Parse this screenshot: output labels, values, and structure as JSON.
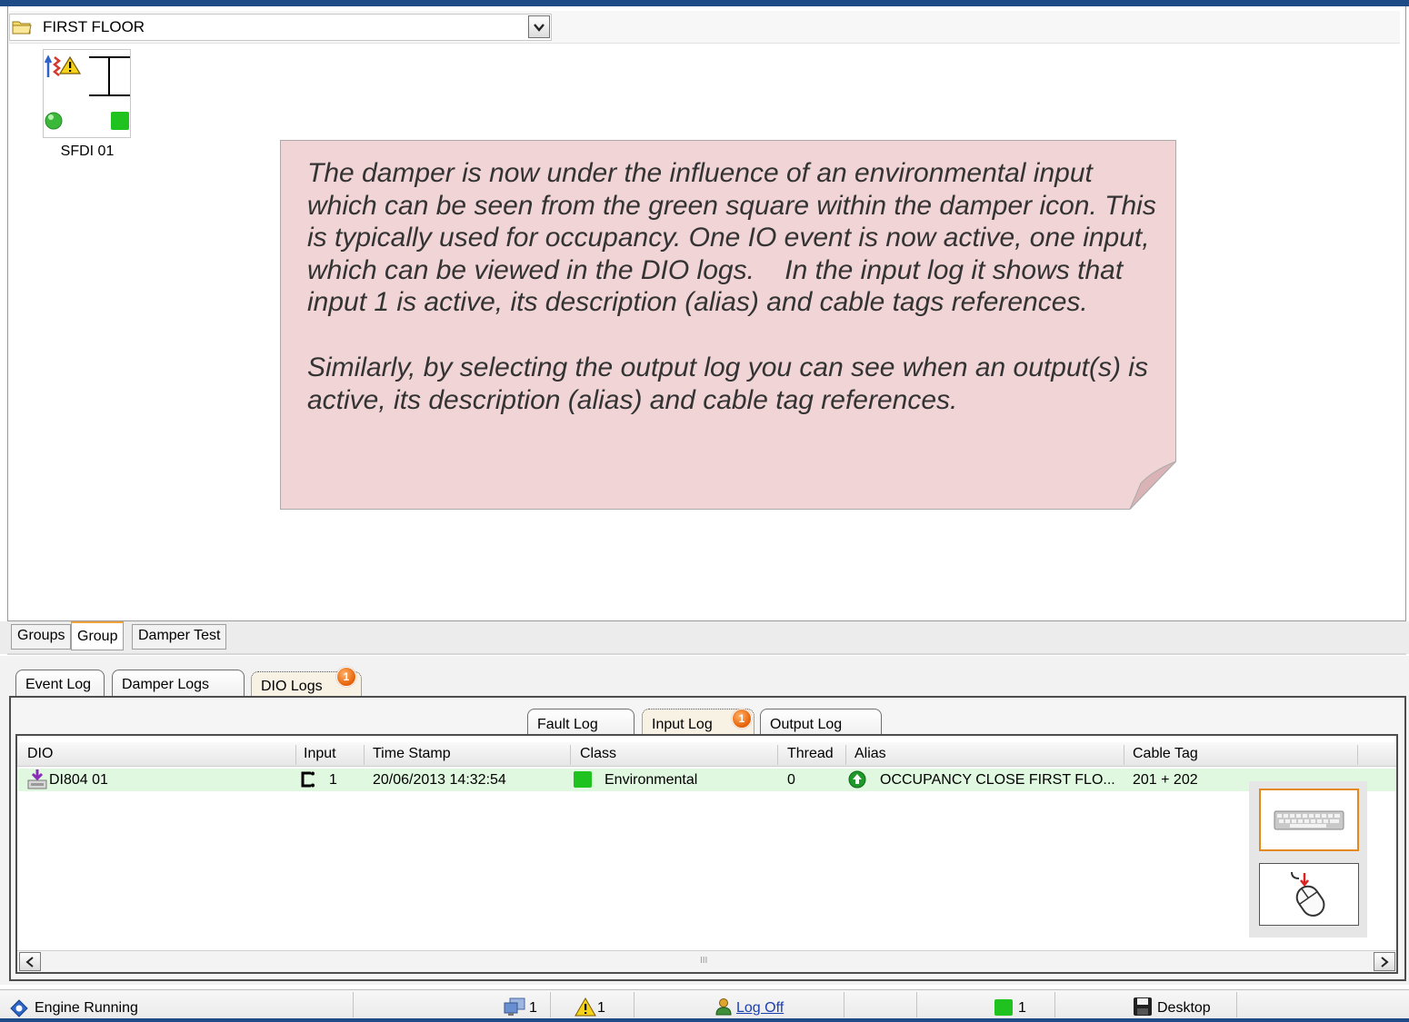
{
  "group_panel": {
    "path_label": "FIRST FLOOR",
    "device": {
      "label": "SFDI 01"
    }
  },
  "note": {
    "paragraph1": "The damper is now under the influence of an environmental input which can be seen from the green square within the damper icon. This is typically used for occupancy. One IO event is now active, one input, which can be viewed in the DIO logs.    In the input log it shows that input 1 is active, its description (alias) and cable tags references.",
    "paragraph2": "Similarly, by selecting the output log you can see when an output(s) is active, its description (alias) and cable tag references."
  },
  "group_tabs": [
    {
      "label": "Groups"
    },
    {
      "label": "Group"
    },
    {
      "label": "Damper Test"
    }
  ],
  "active_group_tab": "Group",
  "log_tabs": [
    {
      "label": "Event Log"
    },
    {
      "label": "Damper Logs"
    },
    {
      "label": "DIO Logs",
      "badge": "1"
    }
  ],
  "active_log_tab": "DIO Logs",
  "dio_tabs": [
    {
      "label": "Fault Log"
    },
    {
      "label": "Input Log",
      "badge": "1"
    },
    {
      "label": "Output Log"
    }
  ],
  "active_dio_tab": "Input Log",
  "table": {
    "columns": [
      "DIO",
      "Input",
      "Time Stamp",
      "Class",
      "Thread",
      "Alias",
      "Cable Tag"
    ],
    "rows": [
      {
        "dio": "DI804 01",
        "input": "1",
        "time_stamp": "20/06/2013 14:32:54",
        "class": "Environmental",
        "thread": "0",
        "alias": "OCCUPANCY CLOSE FIRST FLO...",
        "cable_tag": "201 + 202"
      }
    ],
    "scroll_grip": "III"
  },
  "status_bar": {
    "engine": "Engine Running",
    "network_count": "1",
    "warning_count": "1",
    "logoff": "Log Off",
    "environmental_count": "1",
    "desktop": "Desktop"
  },
  "colors": {
    "brand_blue": "#1e4a86",
    "row_highlight": "#dff8df",
    "note_fill": "#f0d4d6",
    "badge_orange": "#e8650a",
    "environmental_green": "#1fc21f",
    "active_tab_accent": "#f2a23a"
  },
  "icons": {
    "path": "folder-icon",
    "dropdown": "chevron-down-icon",
    "dio_device": "dio-module-icon",
    "input": "input-bracket-icon",
    "class": "green-square-icon",
    "alias": "green-up-arrow-icon",
    "keyboard_button": "keyboard-icon",
    "mouse_button": "mouse-icon",
    "engine": "engine-icon",
    "network": "network-icon",
    "warning": "warning-icon",
    "user": "user-icon",
    "desktop": "floppy-disk-icon"
  }
}
